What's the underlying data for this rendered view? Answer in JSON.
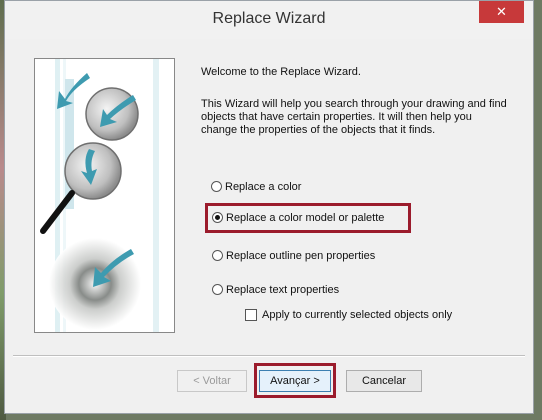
{
  "window": {
    "title": "Replace Wizard",
    "close_label": "✕"
  },
  "intro": {
    "welcome": "Welcome to the Replace Wizard.",
    "description": "This Wizard will help you search through your drawing and find objects that have certain properties. It will then help you change the properties of the objects that it finds."
  },
  "options": {
    "replace_color": "Replace a color",
    "replace_color_model": "Replace a color model or palette",
    "replace_outline": "Replace outline pen properties",
    "replace_text": "Replace text properties",
    "apply_selected": "Apply to currently selected objects only",
    "selected": "replace_color_model",
    "apply_selected_checked": false
  },
  "buttons": {
    "back": "< Voltar",
    "next": "Avançar >",
    "cancel": "Cancelar"
  },
  "colors": {
    "highlight": "#9b1b2c",
    "close": "#c7393a",
    "arrow": "#3e9bb0"
  }
}
